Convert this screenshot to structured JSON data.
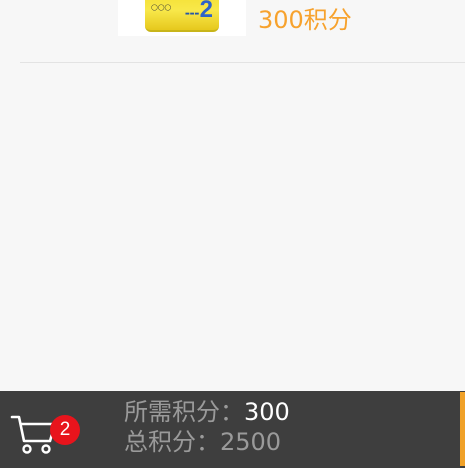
{
  "product": {
    "can_number": "2",
    "points_text": "300积分"
  },
  "cart": {
    "badge_count": "2"
  },
  "summary": {
    "required_label": "所需积分：",
    "required_value": "300",
    "total_label": "总积分：",
    "total_value": "2500"
  },
  "colors": {
    "accent": "#f7a22d",
    "bar_background": "#3e3e3e",
    "badge": "#e8141c"
  }
}
